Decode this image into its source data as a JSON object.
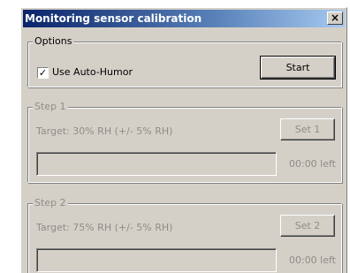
{
  "window": {
    "title": "Monitoring sensor calibration",
    "close_glyph": "✕"
  },
  "options": {
    "legend": "Options",
    "auto_humor": {
      "label": "Use Auto-Humor",
      "checked": true,
      "check_glyph": "✓"
    },
    "start_label": "Start"
  },
  "steps": [
    {
      "legend": "Step 1",
      "target": "Target: 30% RH (+/- 5% RH)",
      "button": "Set 1",
      "progress": 0,
      "time_left": "00:00 left"
    },
    {
      "legend": "Step 2",
      "target": "Target: 75% RH (+/- 5% RH)",
      "button": "Set 2",
      "progress": 0,
      "time_left": "00:00 left"
    }
  ]
}
